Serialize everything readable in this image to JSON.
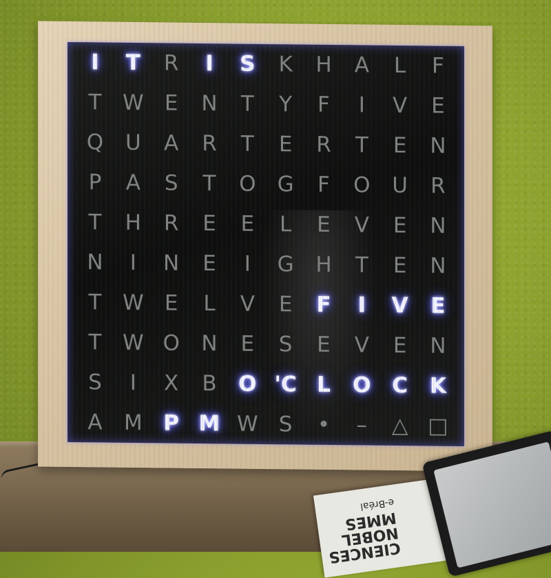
{
  "clock": {
    "rows": [
      {
        "letters": [
          "I",
          "T",
          "R",
          "I",
          "S",
          "K",
          "H",
          "A",
          "L",
          "F"
        ],
        "lit": [
          1,
          1,
          0,
          1,
          1,
          0,
          0,
          0,
          0,
          0
        ]
      },
      {
        "letters": [
          "T",
          "W",
          "E",
          "N",
          "T",
          "Y",
          "F",
          "I",
          "V",
          "E"
        ],
        "lit": [
          0,
          0,
          0,
          0,
          0,
          0,
          0,
          0,
          0,
          0
        ]
      },
      {
        "letters": [
          "Q",
          "U",
          "A",
          "R",
          "T",
          "E",
          "R",
          "T",
          "E",
          "N"
        ],
        "lit": [
          0,
          0,
          0,
          0,
          0,
          0,
          0,
          0,
          0,
          0
        ]
      },
      {
        "letters": [
          "P",
          "A",
          "S",
          "T",
          "O",
          "G",
          "F",
          "O",
          "U",
          "R"
        ],
        "lit": [
          0,
          0,
          0,
          0,
          0,
          0,
          0,
          0,
          0,
          0
        ]
      },
      {
        "letters": [
          "T",
          "H",
          "R",
          "E",
          "E",
          "L",
          "E",
          "V",
          "E",
          "N"
        ],
        "lit": [
          0,
          0,
          0,
          0,
          0,
          0,
          0,
          0,
          0,
          0
        ]
      },
      {
        "letters": [
          "N",
          "I",
          "N",
          "E",
          "I",
          "G",
          "H",
          "T",
          "E",
          "N"
        ],
        "lit": [
          0,
          0,
          0,
          0,
          0,
          0,
          0,
          0,
          0,
          0
        ]
      },
      {
        "letters": [
          "T",
          "W",
          "E",
          "L",
          "V",
          "E",
          "F",
          "I",
          "V",
          "E"
        ],
        "lit": [
          0,
          0,
          0,
          0,
          0,
          0,
          1,
          1,
          1,
          1
        ]
      },
      {
        "letters": [
          "T",
          "W",
          "O",
          "N",
          "E",
          "S",
          "E",
          "V",
          "E",
          "N"
        ],
        "lit": [
          0,
          0,
          0,
          0,
          0,
          0,
          0,
          0,
          0,
          0
        ]
      },
      {
        "letters": [
          "S",
          "I",
          "X",
          "B",
          "O",
          "'C",
          "L",
          "O",
          "C",
          "K"
        ],
        "lit": [
          0,
          0,
          0,
          0,
          1,
          1,
          1,
          1,
          1,
          1
        ]
      },
      {
        "letters": [
          "A",
          "M",
          "P",
          "M",
          "W",
          "S",
          "•",
          "–",
          "△",
          "□"
        ],
        "lit": [
          0,
          0,
          1,
          1,
          0,
          0,
          0,
          0,
          0,
          0
        ]
      }
    ]
  },
  "book": {
    "title_lines": [
      "CIENCES",
      "NOBEL",
      "MMES",
      "e-Bréal"
    ]
  }
}
